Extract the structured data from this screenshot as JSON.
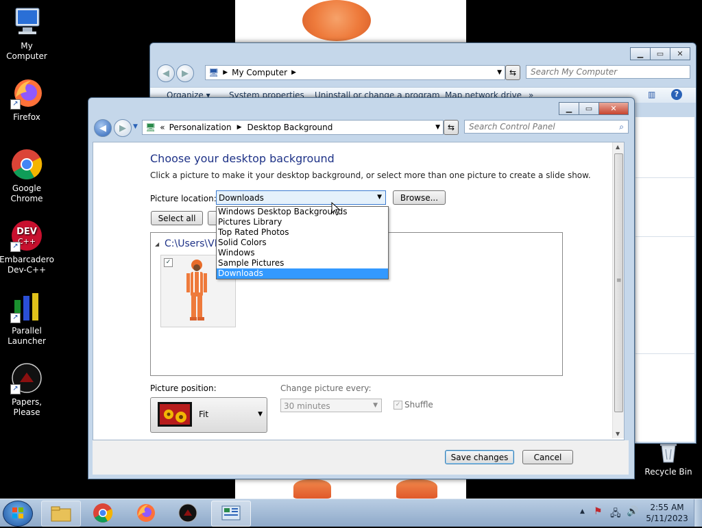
{
  "desktop": {
    "icons": [
      {
        "label": "My Computer"
      },
      {
        "label": "Firefox"
      },
      {
        "label": "Google Chrome"
      },
      {
        "label": "Embarcadero Dev-C++"
      },
      {
        "label": "Parallel Launcher"
      },
      {
        "label": "Papers, Please"
      },
      {
        "label": "Recycle Bin"
      }
    ]
  },
  "explorer_window": {
    "breadcrumb": "My Computer",
    "search_placeholder": "Search My Computer",
    "toolbar": [
      "Organize ▾",
      "System properties",
      "Uninstall or change a program",
      "Map network drive",
      "»"
    ]
  },
  "control_panel": {
    "breadcrumb_root": "«",
    "breadcrumb": [
      "Personalization",
      "Desktop Background"
    ],
    "search_placeholder": "Search Control Panel",
    "heading": "Choose your desktop background",
    "description": "Click a picture to make it your desktop background, or select more than one picture to create a slide show.",
    "picture_location_label": "Picture location:",
    "picture_location_value": "Downloads",
    "browse_label": "Browse...",
    "select_all_label": "Select all",
    "folder_path": "C:\\Users\\VM",
    "location_options": [
      "Windows Desktop Backgrounds",
      "Pictures Library",
      "Top Rated Photos",
      "Solid Colors",
      "Windows",
      "Sample Pictures",
      "Downloads"
    ],
    "selected_option": "Downloads",
    "picture_position_label": "Picture position:",
    "picture_position_value": "Fit",
    "change_every_label": "Change picture every:",
    "change_every_value": "30 minutes",
    "shuffle_label": "Shuffle",
    "save_label": "Save changes",
    "cancel_label": "Cancel"
  },
  "taskbar": {
    "time": "2:55 AM",
    "date": "5/11/2023"
  },
  "colors": {
    "accent": "#3399ff",
    "heading": "#1e3287",
    "window_frame": "#c5d7ea"
  }
}
